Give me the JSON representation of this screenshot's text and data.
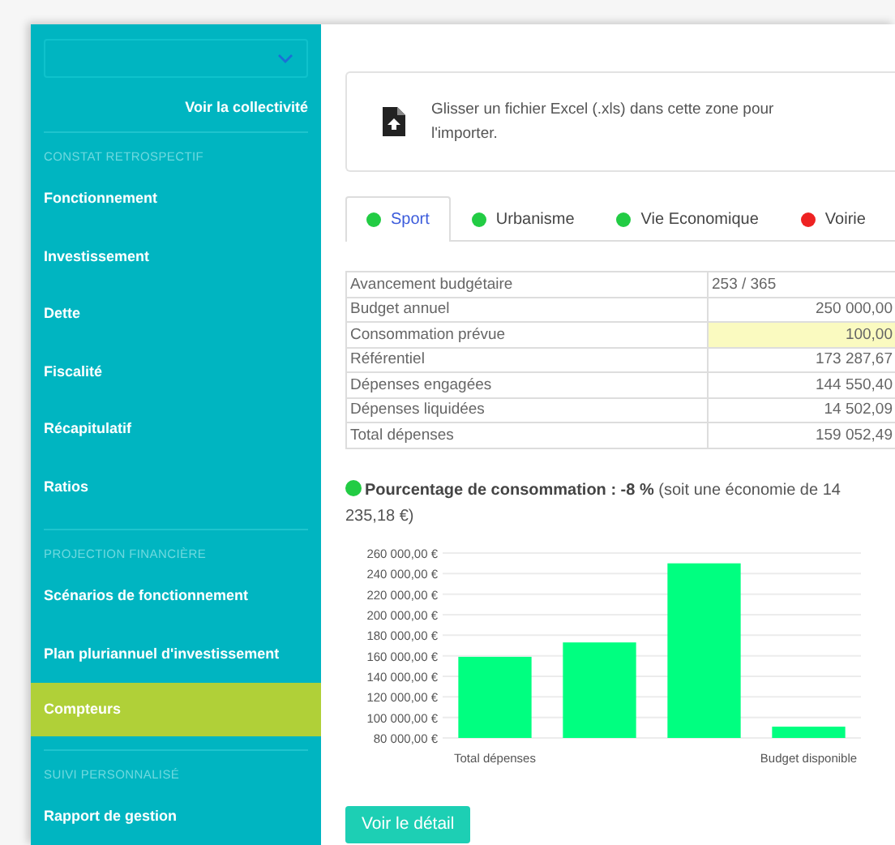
{
  "sidebar": {
    "select": {
      "expanded": false
    },
    "link": "Voir la collectivité",
    "sections": [
      {
        "title": "CONSTAT RETROSPECTIF",
        "items": [
          {
            "label": "Fonctionnement",
            "selected": false
          },
          {
            "label": "Investissement",
            "selected": false
          },
          {
            "label": "Dette",
            "selected": false
          },
          {
            "label": "Fiscalité",
            "selected": false
          },
          {
            "label": "Récapitulatif",
            "selected": false
          },
          {
            "label": "Ratios",
            "selected": false
          }
        ]
      },
      {
        "title": "PROJECTION FINANCIÈRE",
        "items": [
          {
            "label": "Scénarios de fonctionnement",
            "selected": false
          },
          {
            "label": "Plan pluriannuel d'investissement",
            "selected": false
          },
          {
            "label": "Compteurs",
            "selected": true
          }
        ]
      },
      {
        "title": "SUIVI PERSONNALISÉ",
        "items": [
          {
            "label": "Rapport de gestion",
            "selected": false
          }
        ]
      }
    ]
  },
  "upload": {
    "text": "Glisser un fichier Excel (.xls) dans cette zone pour l'importer."
  },
  "tabs": [
    {
      "label": "Sport",
      "selected": true,
      "color": "#22cc44"
    },
    {
      "label": "Urbanisme",
      "selected": false,
      "color": "#22cc44"
    },
    {
      "label": "Vie Economique",
      "selected": false,
      "color": "#22cc44"
    },
    {
      "label": "Voirie",
      "selected": false,
      "color": "#ee2222"
    }
  ],
  "table": {
    "rows": [
      {
        "label": "Avancement budgétaire",
        "value": "253 / 365",
        "kind": "ratio",
        "highlighted": false
      },
      {
        "label": "Budget annuel",
        "value": "250 000,00",
        "kind": "amount",
        "highlighted": false
      },
      {
        "label": "Consommation prévue",
        "value": "100,00",
        "kind": "amount",
        "highlighted": true
      },
      {
        "label": "Référentiel",
        "value": "173 287,67",
        "kind": "amount",
        "highlighted": false
      },
      {
        "label": "Dépenses engagées",
        "value": "144 550,40",
        "kind": "amount",
        "highlighted": false
      },
      {
        "label": "Dépenses liquidées",
        "value": "14 502,09",
        "kind": "amount",
        "highlighted": false
      },
      {
        "label": "Total dépenses",
        "value": "159 052,49",
        "kind": "amount",
        "highlighted": false
      }
    ]
  },
  "summary": {
    "color": "#22cc44",
    "text": "**Pourcentage de consommation : -8 %** (soit une économie de 14 235,18 €)"
  },
  "chart_data": {
    "type": "bar",
    "categories": [
      "Total dépenses",
      null,
      null,
      "Budget disponible"
    ],
    "grid": true,
    "series": [
      {
        "color": "#00ff80",
        "values": [
          159000,
          173000,
          250000,
          91000
        ]
      }
    ],
    "ylim": [
      80000,
      260000
    ],
    "yticks": [
      {
        "value": 80000,
        "label": "80 000,00 €"
      },
      {
        "value": 100000,
        "label": "100 000,00 €"
      },
      {
        "value": 120000,
        "label": "120 000,00 €"
      },
      {
        "value": 140000,
        "label": "140 000,00 €"
      },
      {
        "value": 160000,
        "label": "160 000,00 €"
      },
      {
        "value": 180000,
        "label": "180 000,00 €"
      },
      {
        "value": 200000,
        "label": "200 000,00 €"
      },
      {
        "value": 220000,
        "label": "220 000,00 €"
      },
      {
        "value": 240000,
        "label": "240 000,00 €"
      },
      {
        "value": 260000,
        "label": "260 000,00 €"
      }
    ]
  },
  "button": "Voir le détail"
}
